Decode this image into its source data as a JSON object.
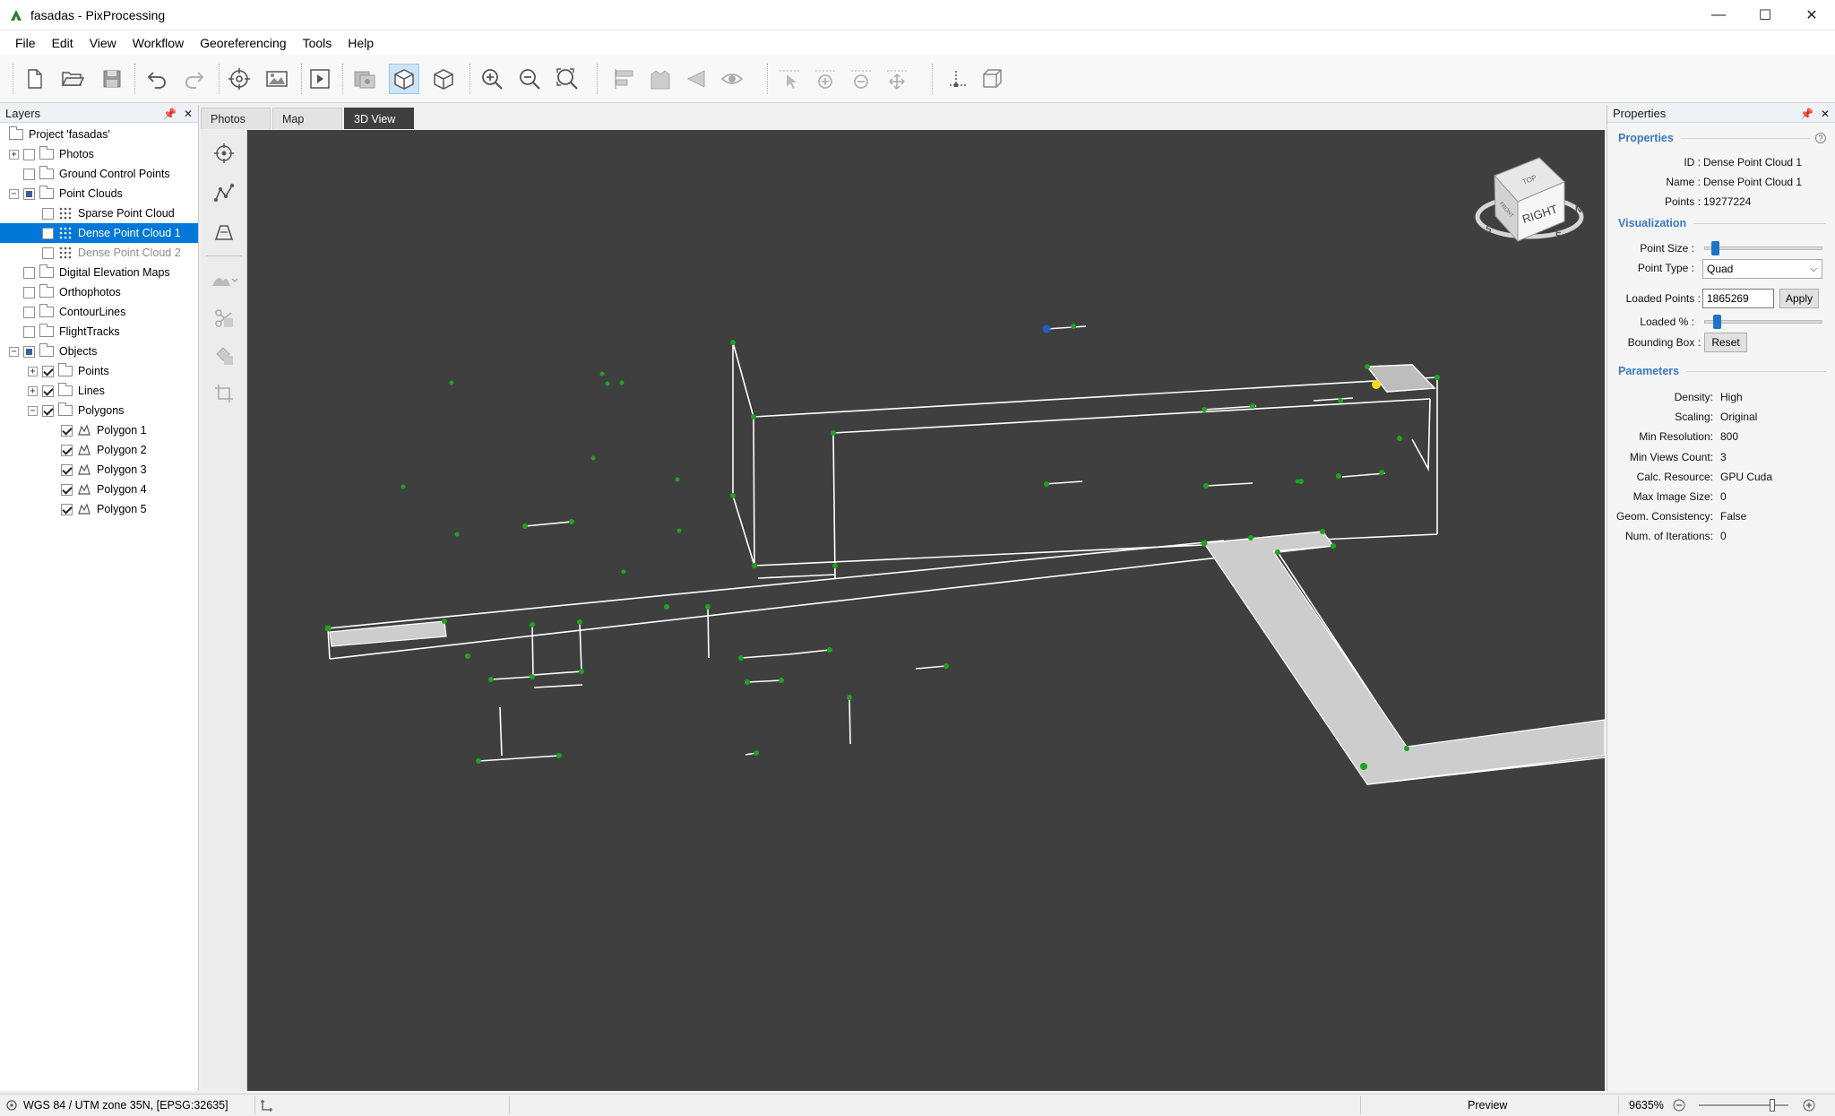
{
  "window": {
    "title": "fasadas - PixProcessing",
    "minimize": "—",
    "maximize": "☐",
    "close": "✕"
  },
  "menu": [
    "File",
    "Edit",
    "View",
    "Workflow",
    "Georeferencing",
    "Tools",
    "Help"
  ],
  "layers_panel": {
    "title": "Layers",
    "items": [
      {
        "label": "Project 'fasadas'",
        "level": 0,
        "expander": "",
        "checkbox": "none",
        "icon": "folder"
      },
      {
        "label": "Photos",
        "level": 0,
        "expander": "+",
        "checkbox": "unchecked",
        "icon": "folder"
      },
      {
        "label": "Ground Control Points",
        "level": 0,
        "expander": "",
        "checkbox": "unchecked",
        "icon": "folder"
      },
      {
        "label": "Point Clouds",
        "level": 0,
        "expander": "−",
        "checkbox": "partial",
        "icon": "folder"
      },
      {
        "label": "Sparse Point Cloud",
        "level": 1,
        "expander": "",
        "checkbox": "unchecked",
        "icon": "pointcloud"
      },
      {
        "label": "Dense Point Cloud 1",
        "level": 1,
        "expander": "",
        "checkbox": "unchecked",
        "icon": "pointcloud",
        "selected": true
      },
      {
        "label": "Dense Point Cloud 2",
        "level": 1,
        "expander": "",
        "checkbox": "unchecked",
        "icon": "pointcloud",
        "dim": true
      },
      {
        "label": "Digital Elevation Maps",
        "level": 0,
        "expander": "",
        "checkbox": "unchecked",
        "icon": "folder"
      },
      {
        "label": "Orthophotos",
        "level": 0,
        "expander": "",
        "checkbox": "unchecked",
        "icon": "folder"
      },
      {
        "label": "ContourLines",
        "level": 0,
        "expander": "",
        "checkbox": "unchecked",
        "icon": "folder"
      },
      {
        "label": "FlightTracks",
        "level": 0,
        "expander": "",
        "checkbox": "unchecked",
        "icon": "folder"
      },
      {
        "label": "Objects",
        "level": 0,
        "expander": "−",
        "checkbox": "partial",
        "icon": "folder"
      },
      {
        "label": "Points",
        "level": 1,
        "expander": "+",
        "checkbox": "checked",
        "icon": "folder"
      },
      {
        "label": "Lines",
        "level": 1,
        "expander": "+",
        "checkbox": "checked",
        "icon": "folder"
      },
      {
        "label": "Polygons",
        "level": 1,
        "expander": "−",
        "checkbox": "checked",
        "icon": "folder"
      },
      {
        "label": "Polygon 1",
        "level": 2,
        "expander": "",
        "checkbox": "checked",
        "icon": "polygon"
      },
      {
        "label": "Polygon 2",
        "level": 2,
        "expander": "",
        "checkbox": "checked",
        "icon": "polygon"
      },
      {
        "label": "Polygon 3",
        "level": 2,
        "expander": "",
        "checkbox": "checked",
        "icon": "polygon"
      },
      {
        "label": "Polygon 4",
        "level": 2,
        "expander": "",
        "checkbox": "checked",
        "icon": "polygon"
      },
      {
        "label": "Polygon 5",
        "level": 2,
        "expander": "",
        "checkbox": "checked",
        "icon": "polygon"
      }
    ]
  },
  "tabs": [
    {
      "label": "Photos",
      "active": false
    },
    {
      "label": "Map",
      "active": false
    },
    {
      "label": "3D View",
      "active": true
    }
  ],
  "viewcube": {
    "face_label": "RIGHT",
    "top_label": "TOP",
    "front_label": "FRONT",
    "compass": [
      "S",
      "E",
      "N"
    ]
  },
  "properties_panel": {
    "title": "Properties",
    "sections": {
      "properties": "Properties",
      "visualization": "Visualization",
      "parameters": "Parameters"
    },
    "info": [
      {
        "key": "ID :",
        "value": "Dense Point Cloud 1"
      },
      {
        "key": "Name :",
        "value": "Dense Point Cloud 1"
      },
      {
        "key": "Points :",
        "value": "19277224"
      }
    ],
    "visualization": {
      "point_size_label": "Point Size :",
      "point_size_level": 0.08,
      "point_type_label": "Point Type :",
      "point_type_value": "Quad",
      "loaded_points_label": "Loaded Points :",
      "loaded_points_value": "1865269",
      "apply_label": "Apply",
      "loaded_pct_label": "Loaded % :",
      "loaded_pct_level": 0.1,
      "bounding_box_label": "Bounding Box :",
      "reset_label": "Reset"
    },
    "parameters": [
      {
        "key": "Density:",
        "value": "High"
      },
      {
        "key": "Scaling:",
        "value": "Original"
      },
      {
        "key": "Min Resolution:",
        "value": "800"
      },
      {
        "key": "Min Views Count:",
        "value": "3"
      },
      {
        "key": "Calc. Resource:",
        "value": "GPU Cuda"
      },
      {
        "key": "Max Image Size:",
        "value": "0"
      },
      {
        "key": "Geom. Consistency:",
        "value": "False"
      },
      {
        "key": "Num. of Iterations:",
        "value": "0"
      }
    ]
  },
  "statusbar": {
    "crs": "WGS 84 / UTM zone 35N, [EPSG:32635]",
    "mode": "Preview",
    "zoom": "9635%",
    "zoom_level": 0.82
  },
  "colors": {
    "accent": "#0078d7",
    "canvas": "#3f3f3f",
    "section_title": "#3a78c3",
    "node": "#1fa31f"
  }
}
